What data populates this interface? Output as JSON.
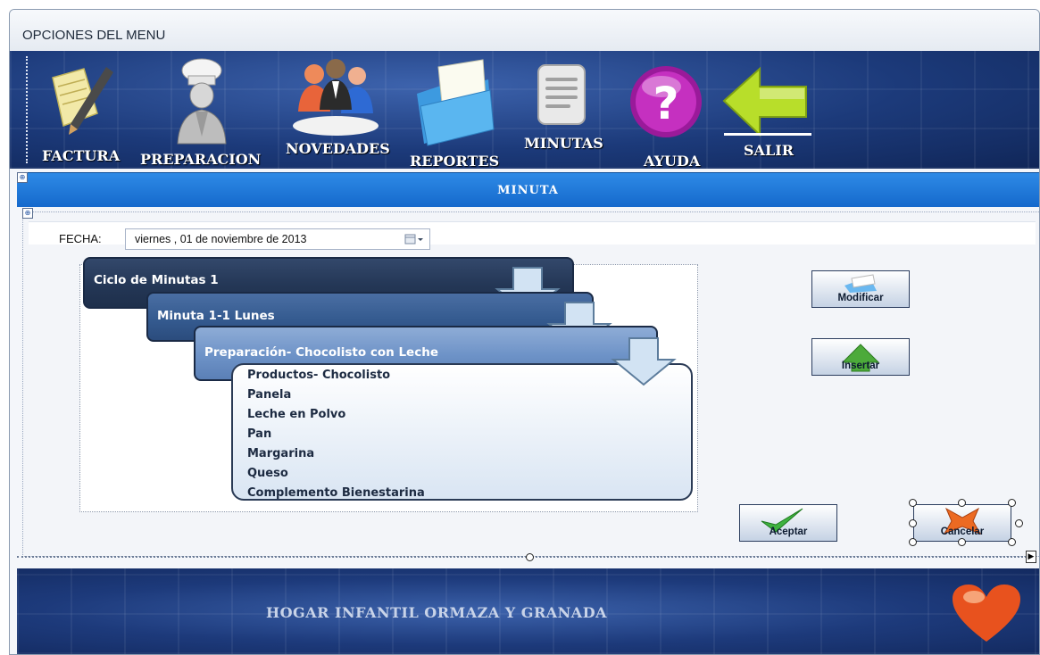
{
  "window": {
    "title": "OPCIONES DEL MENU"
  },
  "toolbar": {
    "factura": "FACTURA",
    "preparacion": "PREPARACION",
    "novedades": "NOVEDADES",
    "reportes": "REPORTES",
    "minutas": "MINUTAS",
    "ayuda": "AYUDA",
    "salir": "SALIR"
  },
  "section": {
    "title": "MINUTA"
  },
  "date": {
    "label": "FECHA:",
    "value": "viernes , 01 de noviembre de 2013"
  },
  "hierarchy": {
    "level1": "Ciclo de Minutas 1",
    "level2": "Minuta 1-1 Lunes",
    "level3": "Preparación- Chocolisto con Leche",
    "items": [
      "Productos- Chocolisto",
      "Panela",
      "Leche en Polvo",
      "Pan",
      "Margarina",
      "Queso",
      "Complemento Bienestarina"
    ]
  },
  "actions": {
    "modificar": "Modificar",
    "insertar": "Insertar",
    "aceptar": "Aceptar",
    "cancelar": "Cancelar"
  },
  "footer": {
    "title": "HOGAR INFANTIL ORMAZA Y GRANADA"
  },
  "colors": {
    "toolbar": "#1c3a7a",
    "band": "#1a6fd4",
    "accent_green": "#3aa03a",
    "accent_orange": "#e8641e"
  }
}
